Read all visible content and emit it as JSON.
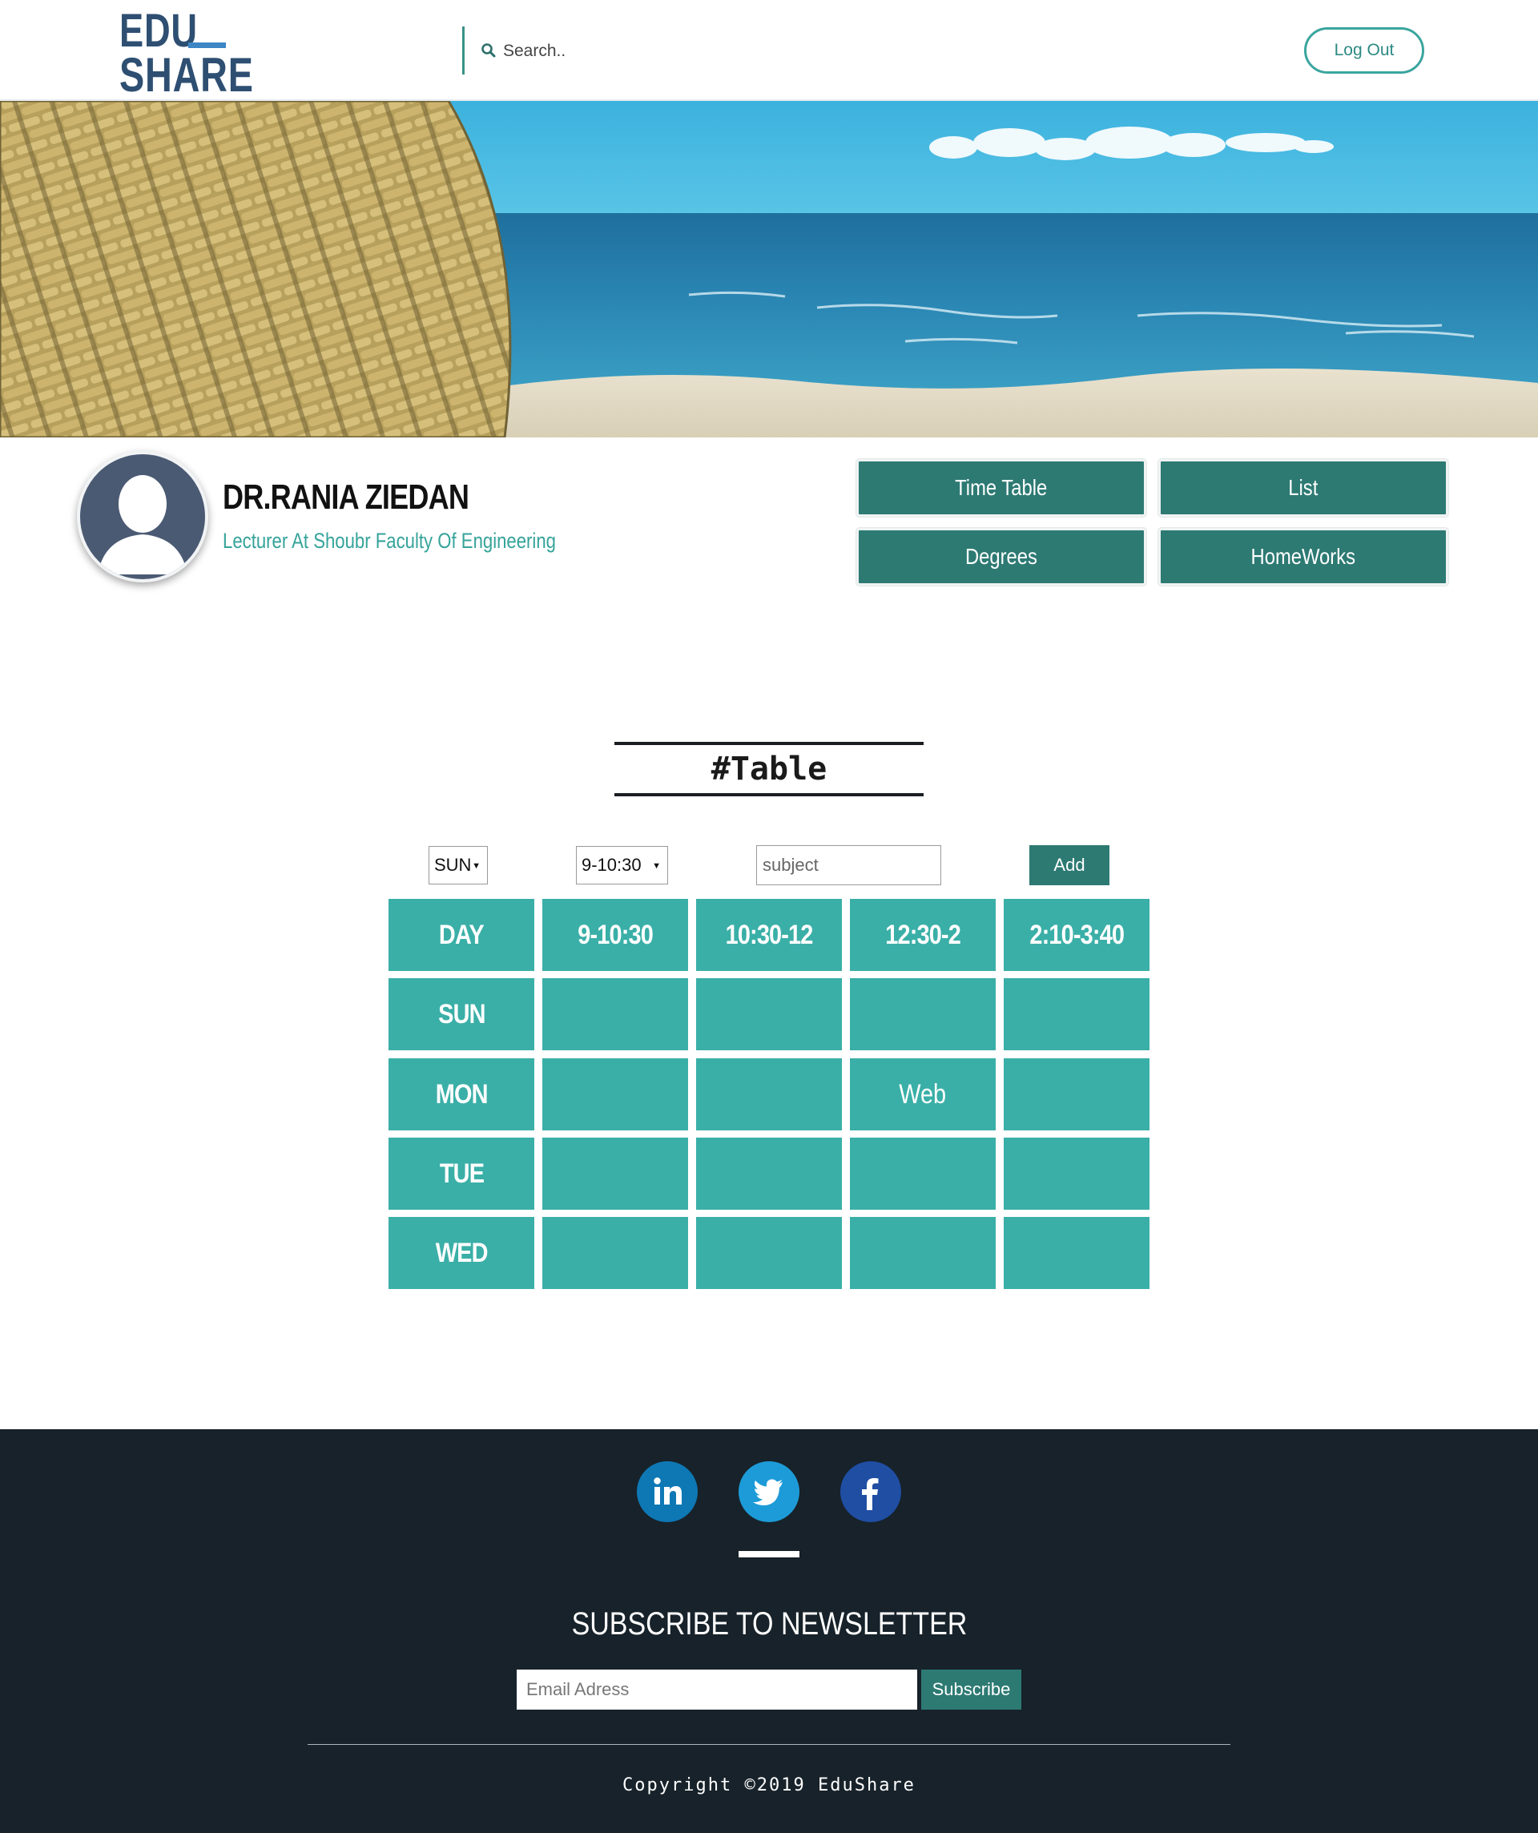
{
  "header": {
    "logo_line1": "EDU",
    "logo_line2": "SHARE",
    "search_placeholder": "Search..",
    "logout_label": "Log Out"
  },
  "profile": {
    "name": "DR.RANIA ZIEDAN",
    "role": "Lecturer At Shoubr Faculty Of Engineering",
    "nav_buttons": [
      "Time Table",
      "List",
      "Degrees",
      "HomeWorks"
    ]
  },
  "timetable": {
    "title": "#Table",
    "day_select": "SUN",
    "time_select": "9-10:30",
    "subject_placeholder": "subject",
    "add_label": "Add",
    "headers": [
      "DAY",
      "9-10:30",
      "10:30-12",
      "12:30-2",
      "2:10-3:40"
    ],
    "rows": [
      {
        "day": "SUN",
        "slots": [
          "",
          "",
          "",
          ""
        ]
      },
      {
        "day": "MON",
        "slots": [
          "",
          "",
          "Web",
          ""
        ]
      },
      {
        "day": "TUE",
        "slots": [
          "",
          "",
          "",
          ""
        ]
      },
      {
        "day": "WED",
        "slots": [
          "",
          "",
          "",
          ""
        ]
      }
    ]
  },
  "footer": {
    "social": [
      "linkedin-icon",
      "twitter-icon",
      "facebook-icon"
    ],
    "newsletter_title": "SUBSCRIBE TO NEWSLETTER",
    "email_placeholder": "Email Adress",
    "subscribe_label": "Subscribe",
    "copyright": "Copyright ©2019 EduShare"
  },
  "colors": {
    "brand_dark": "#2e4f72",
    "accent_teal": "#3aafa7",
    "button_teal": "#2d7a73",
    "footer_bg": "#17222a"
  }
}
